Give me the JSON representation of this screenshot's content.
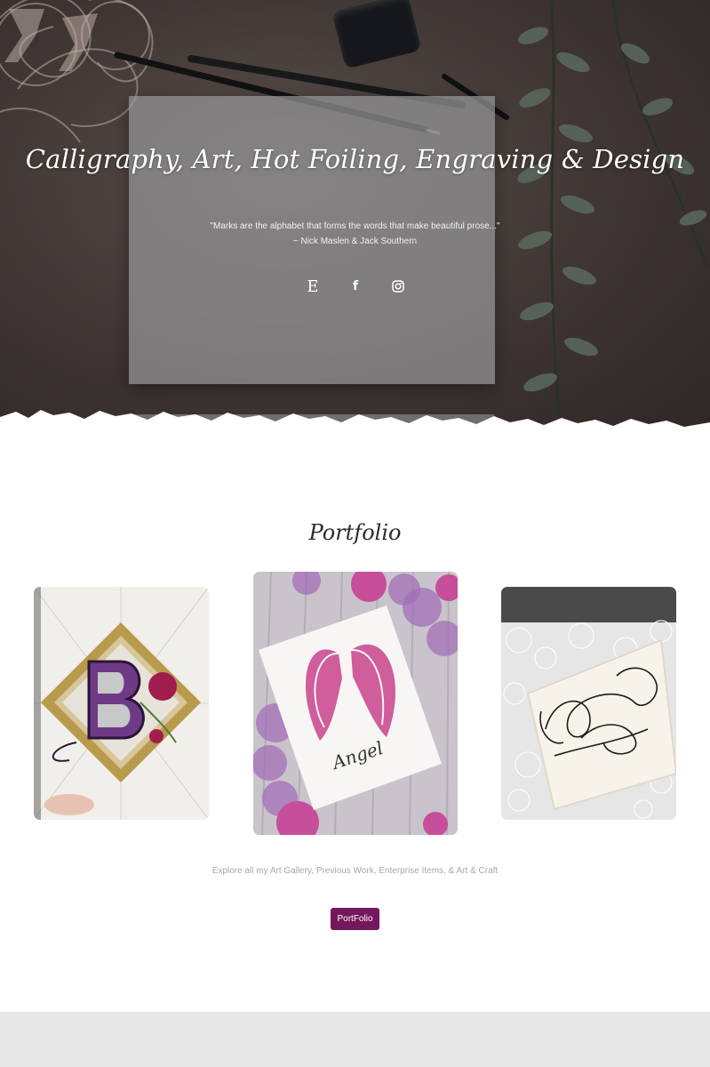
{
  "hero": {
    "title": "Calligraphy, Art, Hot Foiling, Engraving & Design",
    "quote_line1": "\"Marks are the alphabet that forms the words that make beautiful prose...\"",
    "quote_line2": "~ Nick Maslen & Jack Southern",
    "socials": [
      {
        "name": "etsy-icon",
        "glyph": "E"
      },
      {
        "name": "facebook-icon",
        "glyph": "f"
      },
      {
        "name": "instagram-icon",
        "glyph": ""
      }
    ]
  },
  "portfolio": {
    "title": "Portfolio",
    "card2_script": "Angel",
    "explore_text": "Explore all my Art Gallery, Previous Work, Enterprise Items, & Art & Craft",
    "button_label": "PortFolio"
  },
  "colors": {
    "accent": "#74175c",
    "hero_bg": "#3e3532",
    "footer_band": "#e6e6e6"
  }
}
